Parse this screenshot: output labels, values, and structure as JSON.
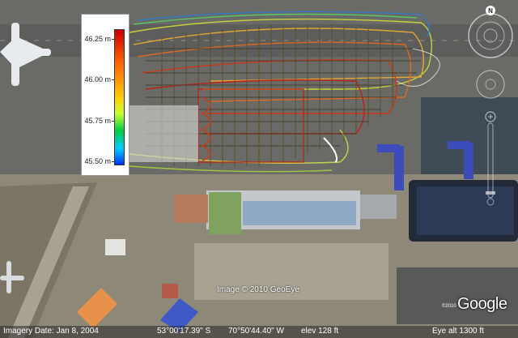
{
  "legend": {
    "ticks": [
      "46.25 m",
      "46.00 m",
      "45.75 m",
      "45.50 m"
    ],
    "colors": [
      "#cc0000",
      "#ff6600",
      "#ffcc00",
      "#ccff33",
      "#00cc44",
      "#00ccff",
      "#0033ff"
    ]
  },
  "attribution": {
    "copyright": "Image © 2010 GeoEye",
    "logo": "Google",
    "logo_year": "©2010"
  },
  "status": {
    "imagery_date": "Imagery Date: Jan  8, 2004",
    "latitude": "53°00'17.39\" S",
    "longitude": "70°50'44.40\" W",
    "elevation": "elev   128 ft",
    "eye_alt": "Eye alt   1300 ft"
  },
  "navigation": {
    "north_label": "N"
  },
  "icons": [
    "compass-icon",
    "look-joystick-icon",
    "move-joystick-icon",
    "zoom-slider-icon"
  ]
}
